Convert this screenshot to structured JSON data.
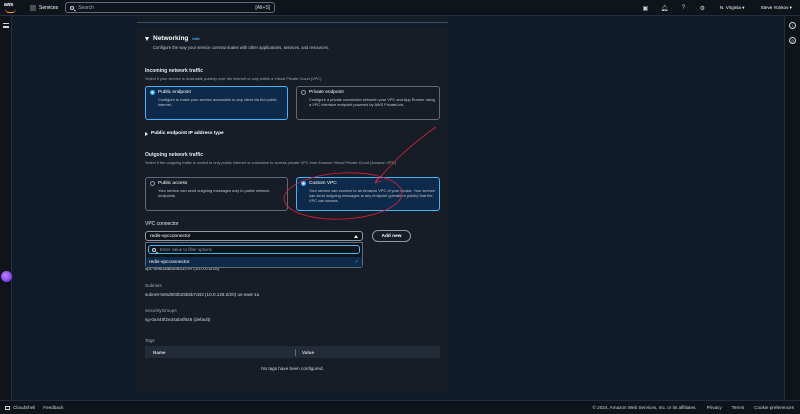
{
  "topnav": {
    "logo": "aws",
    "services_label": "Services",
    "search_placeholder": "Search",
    "search_shortcut": "[Alt+S]",
    "region": "N. Virginia ▾",
    "user": "Steve Yonkov ▾"
  },
  "networking": {
    "title": "Networking",
    "info": "Info",
    "description": "Configure the way your service communicates with other applications, services, and resources.",
    "incoming": {
      "label": "Incoming network traffic",
      "help": "Select if your service is reachable publicly over the internet or only within a Virtual Private Cloud (VPC)",
      "options": [
        {
          "title": "Public endpoint",
          "desc": "Configure to make your service accessible to any client via the public internet.",
          "selected": true
        },
        {
          "title": "Private endpoint",
          "desc": "Configure a private connection between your VPC and App Runner using a VPC interface endpoint powered by AWS PrivateLink.",
          "selected": false
        }
      ]
    },
    "expander": "Public endpoint IP address type",
    "outgoing": {
      "label": "Outgoing network traffic",
      "help": "Select if the outgoing traffic is routed to only public Internet or customize to access private VPC from Amazon Virtual Private Cloud (Amazon VPC)",
      "options": [
        {
          "title": "Public access",
          "desc": "Your service can send outgoing messages only to public network endpoints.",
          "selected": false
        },
        {
          "title": "Custom VPC",
          "desc": "Your service can connect to an Amazon VPC of your choice. Your service can send outgoing messages to any endpoint (private or public) that the VPC can access.",
          "selected": true
        }
      ]
    },
    "vpc_connector": {
      "label": "VPC connector",
      "selected_value": "redis-vpcconnector",
      "add_button": "Add new",
      "filter_placeholder": "Enter value to filter options",
      "options": [
        "redis-vpcconnector"
      ],
      "partial_vpc_text": "vpc-0e6d3a93fab1b7ef (10.0.0.0/16)"
    },
    "subnets": {
      "label": "Subnets",
      "value": "subnet-0e5d903b25b6b7d43 (10.0.128.0/20) us-east-1a"
    },
    "security_groups": {
      "label": "SecurityGroups",
      "value": "sg-0a445f2e34ab4f646 (default)"
    },
    "tags": {
      "label": "Tags",
      "columns": [
        "Name",
        "Value"
      ],
      "empty_text": "No tags have been configured."
    }
  },
  "footer": {
    "cloudshell": "CloudShell",
    "feedback": "Feedback",
    "copyright": "© 2024, Amazon Web Services, Inc. or its affiliates.",
    "privacy": "Privacy",
    "terms": "Terms",
    "cookies": "Cookie preferences"
  },
  "colors": {
    "accent": "#42b4ff",
    "annotation": "#e0203a",
    "panel": "#161d26",
    "background": "#0f1b2a"
  }
}
